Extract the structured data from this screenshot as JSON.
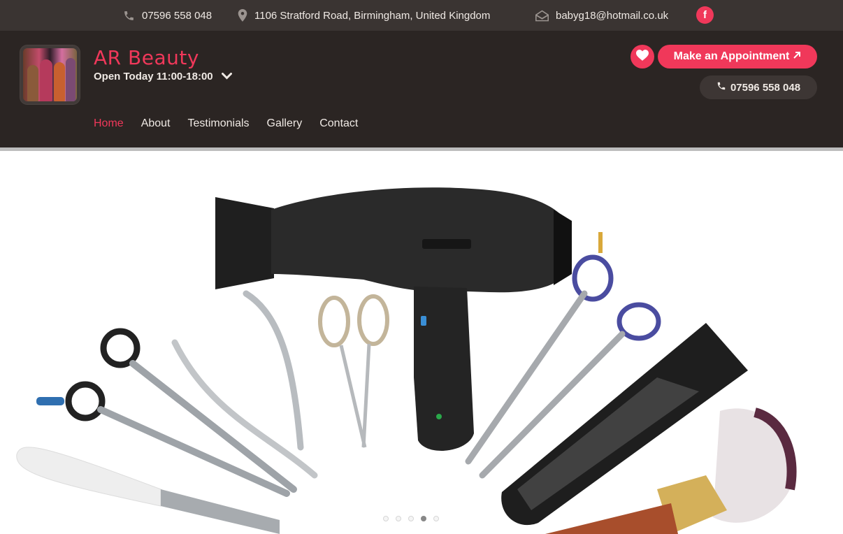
{
  "topbar": {
    "phone": "07596 558 048",
    "address": "1106 Stratford Road, Birmingham, United Kingdom",
    "email": "babyg18@hotmail.co.uk",
    "phone_icon": "phone-icon",
    "location_icon": "map-pin-icon",
    "email_icon": "envelope-icon",
    "social_icon": "facebook-icon",
    "social_glyph": "f"
  },
  "header": {
    "business_name": "AR Beauty",
    "hours": "Open Today 11:00-18:00",
    "appointment_label": "Make an Appointment",
    "phone_label": "07596 558 048"
  },
  "nav": {
    "items": [
      {
        "label": "Home",
        "active": true
      },
      {
        "label": "About",
        "active": false
      },
      {
        "label": "Testimonials",
        "active": false
      },
      {
        "label": "Gallery",
        "active": false
      },
      {
        "label": "Contact",
        "active": false
      }
    ]
  },
  "colors": {
    "accent": "#f0385a",
    "header_bg": "#2b2523",
    "topbar_bg": "#3a3432"
  }
}
